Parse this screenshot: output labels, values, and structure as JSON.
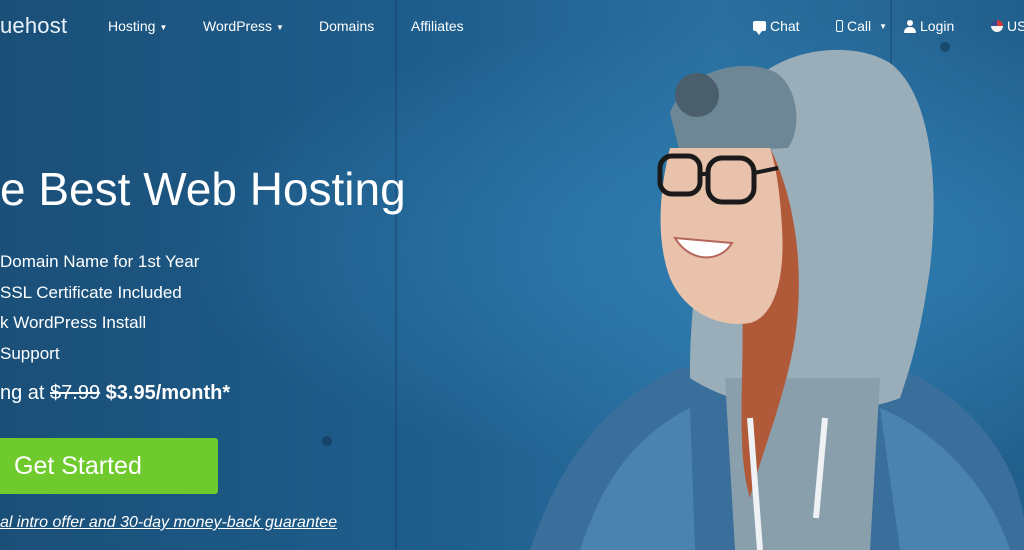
{
  "nav": {
    "logo": "uehost",
    "menu": [
      {
        "label": "Hosting",
        "dropdown": true
      },
      {
        "label": "WordPress",
        "dropdown": true
      },
      {
        "label": "Domains",
        "dropdown": false
      },
      {
        "label": "Affiliates",
        "dropdown": false
      }
    ],
    "utility": {
      "chat": "Chat",
      "call": "Call",
      "login": "Login",
      "locale": "US"
    }
  },
  "hero": {
    "headline": "e Best Web Hosting",
    "features": [
      "Domain Name for 1st Year",
      "SSL Certificate Included",
      "k WordPress Install",
      "Support"
    ],
    "price": {
      "prefix": "ng at",
      "old": "$7.99",
      "new": "$3.95/month*"
    },
    "cta_label": "Get Started",
    "guarantee": "al intro offer and 30-day money-back guarantee"
  },
  "colors": {
    "background": "#1f5f8e",
    "cta": "#6fca2e",
    "text": "#ffffff"
  },
  "icons": [
    "chat-icon",
    "phone-icon",
    "user-icon",
    "flag-icon"
  ]
}
